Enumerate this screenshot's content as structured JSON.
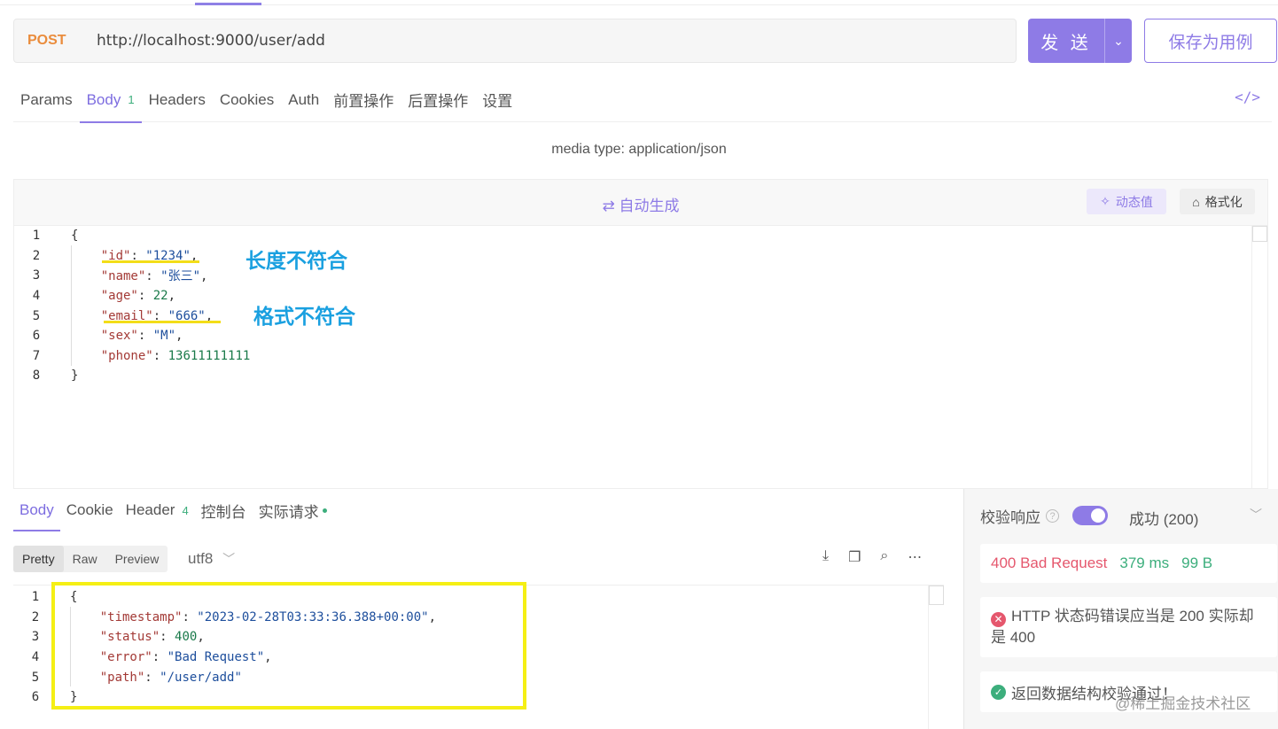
{
  "request": {
    "method": "POST",
    "url": "http://localhost:9000/user/add",
    "send_label": "发 送",
    "save_label": "保存为用例",
    "tabs": [
      {
        "label": "Params"
      },
      {
        "label": "Body",
        "count": "1"
      },
      {
        "label": "Headers"
      },
      {
        "label": "Cookies"
      },
      {
        "label": "Auth"
      },
      {
        "label": "前置操作"
      },
      {
        "label": "后置操作"
      },
      {
        "label": "设置"
      }
    ],
    "code_toggle": "</>"
  },
  "body": {
    "media_type": "media type: application/json",
    "auto_generate": "⇄ 自动生成",
    "dynamic_value": "动态值",
    "format": "格式化",
    "lines": [
      {
        "n": "1",
        "text": "{"
      },
      {
        "n": "2",
        "key": "\"id\"",
        "val": "\"1234\"",
        "tail": ","
      },
      {
        "n": "3",
        "key": "\"name\"",
        "val": "\"张三\"",
        "tail": ","
      },
      {
        "n": "4",
        "key": "\"age\"",
        "num": "22",
        "tail": ","
      },
      {
        "n": "5",
        "key": "\"email\"",
        "val": "\"666\"",
        "tail": ","
      },
      {
        "n": "6",
        "key": "\"sex\"",
        "val": "\"M\"",
        "tail": ","
      },
      {
        "n": "7",
        "key": "\"phone\"",
        "num": "13611111111",
        "tail": ""
      },
      {
        "n": "8",
        "text": "}"
      }
    ],
    "annotations": {
      "length": "长度不符合",
      "format": "格式不符合"
    }
  },
  "response": {
    "tabs": [
      {
        "label": "Body"
      },
      {
        "label": "Cookie"
      },
      {
        "label": "Header",
        "count": "4"
      },
      {
        "label": "控制台"
      },
      {
        "label": "实际请求"
      }
    ],
    "view_modes": [
      "Pretty",
      "Raw",
      "Preview"
    ],
    "encoding": "utf8",
    "lines": [
      {
        "n": "1",
        "text": "{"
      },
      {
        "n": "2",
        "key": "\"timestamp\"",
        "val": "\"2023-02-28T03:33:36.388+00:00\"",
        "tail": ","
      },
      {
        "n": "3",
        "key": "\"status\"",
        "num": "400",
        "tail": ","
      },
      {
        "n": "4",
        "key": "\"error\"",
        "val": "\"Bad Request\"",
        "tail": ","
      },
      {
        "n": "5",
        "key": "\"path\"",
        "val": "\"/user/add\"",
        "tail": ""
      },
      {
        "n": "6",
        "text": "}"
      }
    ]
  },
  "validation": {
    "label": "校验响应",
    "toggle_on": true,
    "status": "成功 (200)",
    "result_status": "400 Bad Request",
    "time": "379 ms",
    "size": "99 B",
    "error_msg": "HTTP 状态码错误应当是 200 实际却是 400",
    "ok_msg": "返回数据结构校验通过！"
  },
  "watermark": "@稀土掘金技术社区",
  "colors": {
    "accent": "#8e7be6",
    "method": "#ea8c3c",
    "error": "#e5576d",
    "success": "#3cae7c",
    "annotation": "#1aa0e0",
    "highlight": "#f5ef14"
  }
}
